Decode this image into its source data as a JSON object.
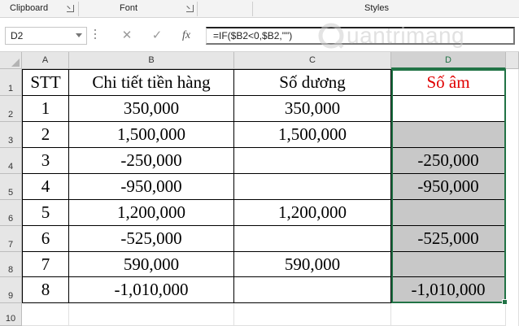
{
  "ribbon": {
    "clipboard": "Clipboard",
    "font": "Font",
    "styles": "Styles"
  },
  "formula_bar": {
    "name_box": "D2",
    "cancel_icon": "✕",
    "enter_icon": "✓",
    "fx": "fx",
    "formula": "=IF($B2<0,$B2,\"\")"
  },
  "watermark": "uantrimang",
  "columns": [
    "A",
    "B",
    "C",
    "D"
  ],
  "rows": [
    "1",
    "2",
    "3",
    "4",
    "5",
    "6",
    "7",
    "8",
    "9",
    "10"
  ],
  "sheet": {
    "header": [
      "STT",
      "Chi tiết tiền hàng",
      "Số dương",
      "Số âm"
    ],
    "data": [
      [
        "1",
        "350,000",
        "350,000",
        ""
      ],
      [
        "2",
        "1,500,000",
        "1,500,000",
        ""
      ],
      [
        "3",
        "-250,000",
        "",
        "-250,000"
      ],
      [
        "4",
        "-950,000",
        "",
        "-950,000"
      ],
      [
        "5",
        "1,200,000",
        "1,200,000",
        ""
      ],
      [
        "6",
        "-525,000",
        "",
        "-525,000"
      ],
      [
        "7",
        "590,000",
        "590,000",
        ""
      ],
      [
        "8",
        "-1,010,000",
        "",
        "-1,010,000"
      ]
    ]
  },
  "colors": {
    "accent": "#217346",
    "header_red": "#e00000",
    "conditional_fill": "#c8c8c8"
  }
}
